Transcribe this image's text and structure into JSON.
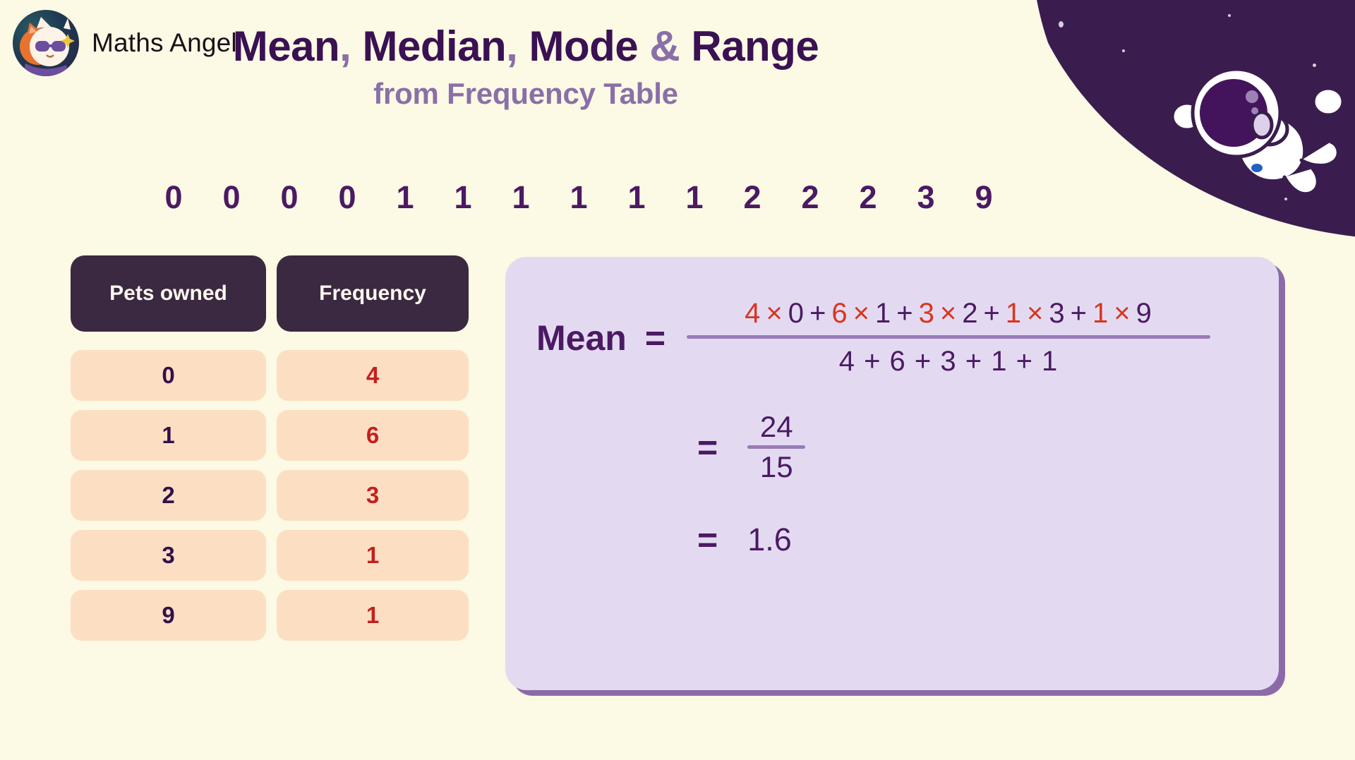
{
  "brand": {
    "name": "Maths Angel",
    "logo_icon": "cat-astronaut-logo-icon"
  },
  "heading": {
    "word1": "Mean",
    "sep1": ",",
    "word2": "Median",
    "sep2": ",",
    "word3": "Mode",
    "amp": "&",
    "word4": "Range",
    "subtitle": "from Frequency Table"
  },
  "decoration": {
    "astronaut_icon": "floating-astronaut-icon",
    "space_blob": "space-blob"
  },
  "sequence": {
    "label": "data-sequence",
    "values": [
      "0",
      "0",
      "0",
      "0",
      "1",
      "1",
      "1",
      "1",
      "1",
      "1",
      "2",
      "2",
      "2",
      "3",
      "9"
    ]
  },
  "table": {
    "headers": [
      "Pets owned",
      "Frequency"
    ],
    "values": [
      "0",
      "1",
      "2",
      "3",
      "9"
    ],
    "frequencies": [
      "4",
      "6",
      "3",
      "1",
      "1"
    ]
  },
  "formula": {
    "label": "Mean",
    "equals": "=",
    "numerator": [
      {
        "t": "4",
        "c": "red"
      },
      {
        "t": "×",
        "c": "red"
      },
      {
        "t": "0",
        "c": "pur"
      },
      {
        "t": "+",
        "c": "pur"
      },
      {
        "t": "6",
        "c": "red"
      },
      {
        "t": "×",
        "c": "red"
      },
      {
        "t": "1",
        "c": "pur"
      },
      {
        "t": "+",
        "c": "pur"
      },
      {
        "t": "3",
        "c": "red"
      },
      {
        "t": "×",
        "c": "red"
      },
      {
        "t": "2",
        "c": "pur"
      },
      {
        "t": "+",
        "c": "pur"
      },
      {
        "t": "1",
        "c": "red"
      },
      {
        "t": "×",
        "c": "red"
      },
      {
        "t": "3",
        "c": "pur"
      },
      {
        "t": "+",
        "c": "pur"
      },
      {
        "t": "1",
        "c": "red"
      },
      {
        "t": "×",
        "c": "red"
      },
      {
        "t": "9",
        "c": "pur"
      }
    ],
    "numerator_text": "4 × 0 + 6 × 1 + 3 × 2 + 1 × 3 + 1 × 9",
    "denominator_text": "4 + 6 + 3 + 1 + 1",
    "step2_equals": "=",
    "step2_numerator": "24",
    "step2_denominator": "15",
    "step3_equals": "=",
    "result": "1.6"
  },
  "colors": {
    "background": "#fcf9e4",
    "heading_dark": "#3a1152",
    "heading_light": "#8a6fa8",
    "table_header_bg": "#3a2940",
    "table_cell_bg": "#fcdfc2",
    "value_text": "#33104a",
    "frequency_text": "#c41f1f",
    "card_bg": "#e3daf2",
    "card_shadow": "#8c6aa8",
    "space_dark": "#3a1d4e"
  }
}
